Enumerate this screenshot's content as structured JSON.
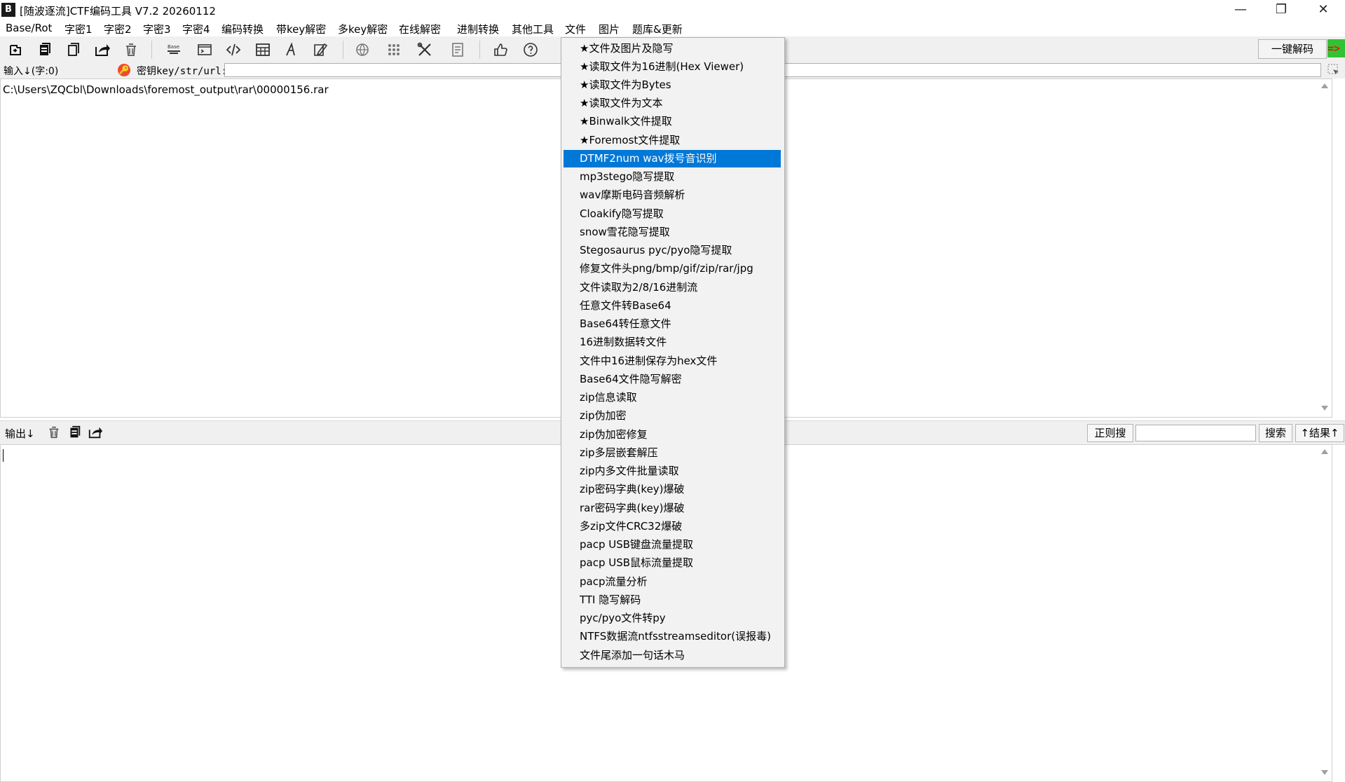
{
  "window": {
    "icon_glyph": "B",
    "title": "[随波逐流]CTF编码工具 V7.2  20260112",
    "minimize_glyph": "—",
    "restore_glyph": "❐",
    "close_glyph": "✕"
  },
  "menubar": {
    "items": [
      "Base/Rot",
      "字密1",
      "字密2",
      "字密3",
      "字密4",
      "编码转换",
      "带key解密",
      "多key解密",
      "在线解密",
      "进制转换",
      "其他工具",
      "文件",
      "图片",
      "题库&更新"
    ]
  },
  "toolbar": {
    "icons": [
      "import-icon",
      "copy-stack-icon",
      "copy-icon",
      "share-icon",
      "trash-icon",
      "base-switch-icon",
      "terminal-icon",
      "code-icon",
      "calculator-icon",
      "font-icon",
      "signature-icon",
      "globe-icon",
      "grid-icon",
      "tools-icon",
      "document-icon",
      "thumbs-up-icon",
      "help-icon"
    ],
    "decode_label": "一键解码",
    "run_glyph": "=>"
  },
  "input": {
    "header_label": "输入↓(字:0)",
    "key_icon_glyph": "🔑",
    "key_label": "密钥key/str/url:",
    "key_value": "",
    "text": "C:\\Users\\ZQCbl\\Downloads\\foremost_output\\rar\\00000156.rar"
  },
  "output": {
    "header_label": "输出↓",
    "regex_label": "正则搜",
    "search_value": "",
    "search_label": "搜索",
    "result_label": "↑结果↑"
  },
  "file_menu": {
    "selected_index": 6,
    "items": [
      "★文件及图片及隐写",
      "★读取文件为16进制(Hex Viewer)",
      "★读取文件为Bytes",
      "★读取文件为文本",
      "★Binwalk文件提取",
      "★Foremost文件提取",
      "DTMF2num  wav拨号音识别",
      "mp3stego隐写提取",
      "wav摩斯电码音频解析",
      "Cloakify隐写提取",
      "snow雪花隐写提取",
      "Stegosaurus pyc/pyo隐写提取",
      "修复文件头png/bmp/gif/zip/rar/jpg",
      "文件读取为2/8/16进制流",
      "任意文件转Base64",
      "Base64转任意文件",
      "16进制数据转文件",
      "文件中16进制保存为hex文件",
      "Base64文件隐写解密",
      "zip信息读取",
      "zip伪加密",
      "zip伪加密修复",
      "zip多层嵌套解压",
      "zip内多文件批量读取",
      "zip密码字典(key)爆破",
      "rar密码字典(key)爆破",
      "多zip文件CRC32爆破",
      "pacp USB键盘流量提取",
      "pacp USB鼠标流量提取",
      "pacp流量分析",
      "TTI 隐写解码",
      "pyc/pyo文件转py",
      "NTFS数据流ntfsstreamseditor(误报毒)",
      "文件尾添加一句话木马"
    ]
  },
  "colors": {
    "selection": "#0078d7",
    "run_button_bg": "#34c234",
    "run_button_fg": "#e31616",
    "key_icon": "#f04a2a"
  }
}
